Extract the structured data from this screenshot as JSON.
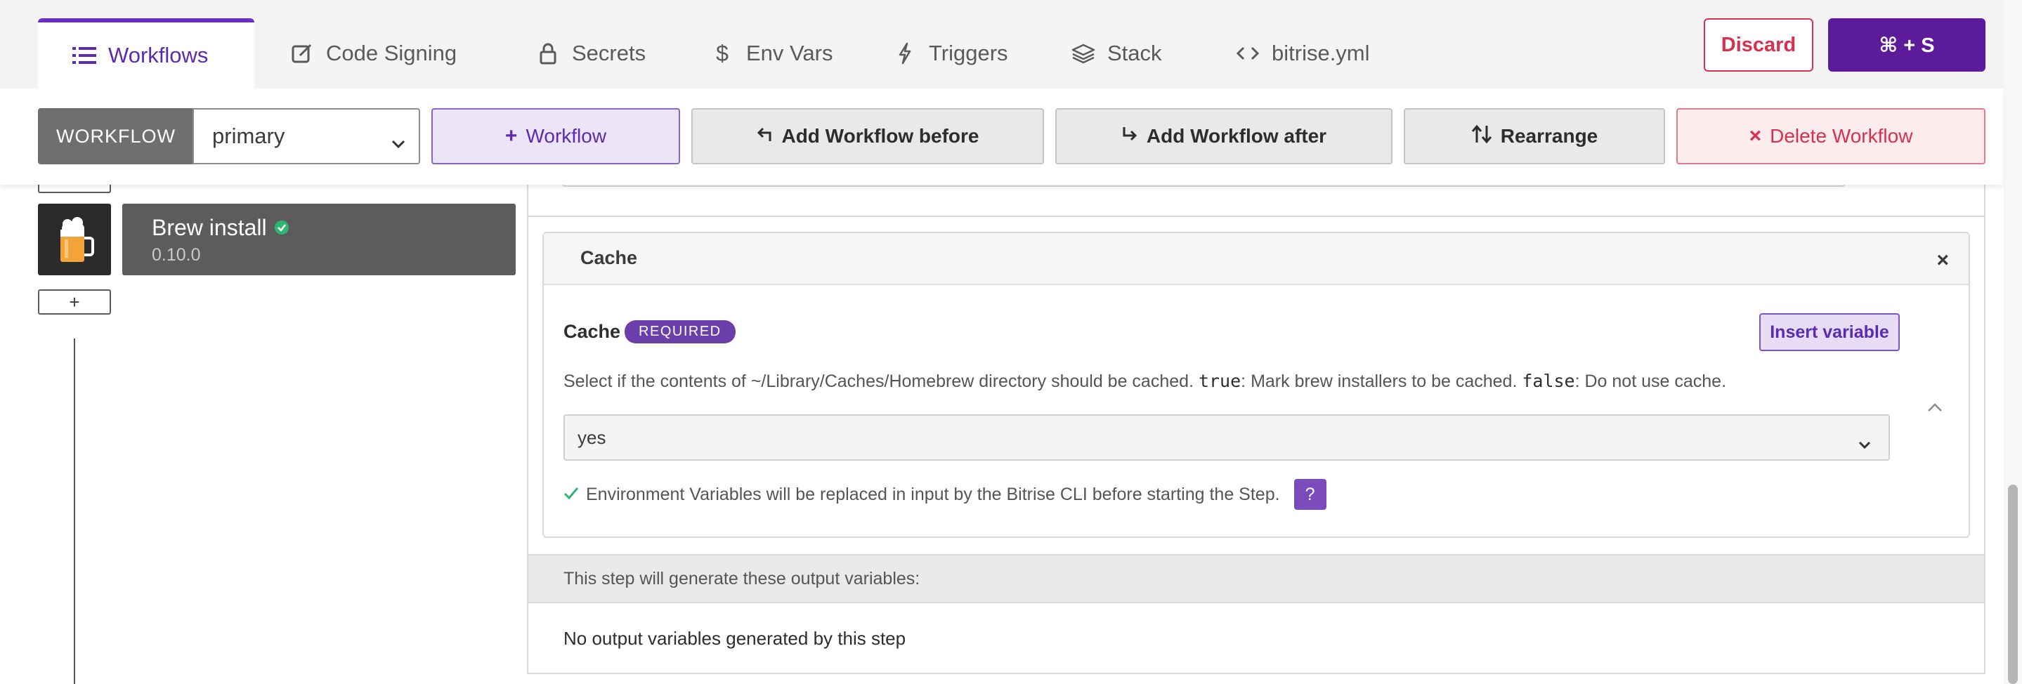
{
  "tabs": [
    {
      "label": "Workflows",
      "icon": "list-icon",
      "active": true
    },
    {
      "label": "Code Signing",
      "icon": "edit-icon"
    },
    {
      "label": "Secrets",
      "icon": "lock-icon"
    },
    {
      "label": "Env Vars",
      "icon": "dollar-icon"
    },
    {
      "label": "Triggers",
      "icon": "bolt-icon"
    },
    {
      "label": "Stack",
      "icon": "layers-icon"
    },
    {
      "label": "bitrise.yml",
      "icon": "code-icon"
    }
  ],
  "header": {
    "discard_label": "Discard",
    "save_label": "⌘ + S"
  },
  "toolbar": {
    "workflow_label": "WORKFLOW",
    "workflow_selected": "primary",
    "add_workflow": "Workflow",
    "add_before": "Add Workflow before",
    "add_after": "Add Workflow after",
    "rearrange": "Rearrange",
    "delete": "Delete Workflow"
  },
  "sidebar": {
    "step": {
      "title": "Brew install",
      "version": "0.10.0",
      "verified": true
    },
    "add_step_label": "+"
  },
  "input_group": {
    "title": "Cache",
    "close_glyph": "×",
    "input_label": "Cache",
    "required_badge": "REQUIRED",
    "insert_variable": "Insert variable",
    "desc_part1": "Select if the contents of ~/Library/Caches/Homebrew directory should be cached. ",
    "desc_code1": "true",
    "desc_part2": ": Mark brew installers to be cached. ",
    "desc_code2": "false",
    "desc_part3": ": Do not use cache.",
    "value": "yes",
    "env_note": "Environment Variables will be replaced in input by the Bitrise CLI before starting the Step.",
    "help_glyph": "?"
  },
  "outputs": {
    "header": "This step will generate these output variables:",
    "empty": "No output variables generated by this step"
  },
  "colors": {
    "accent": "#5b2bb5",
    "save_bg": "#5b1b9a",
    "danger": "#d8304e",
    "verified": "#2fb574"
  }
}
